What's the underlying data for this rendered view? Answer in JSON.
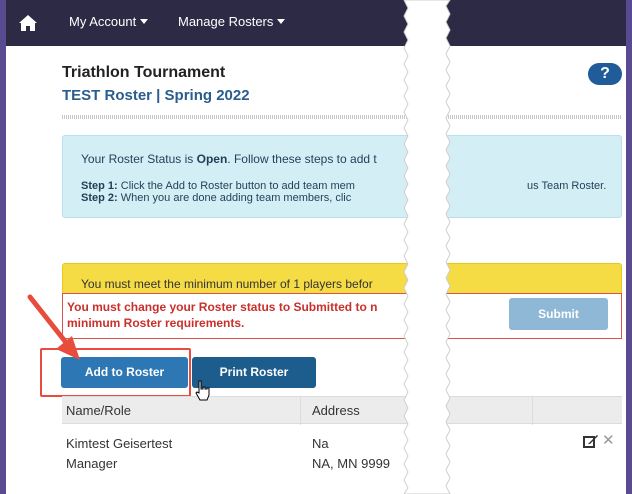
{
  "navbar": {
    "menu": [
      {
        "label": "My Account"
      },
      {
        "label": "Manage Rosters"
      }
    ],
    "colors": {
      "background": "#2c2a44"
    }
  },
  "header": {
    "title": "Triathlon Tournament",
    "subtitle": "TEST Roster | Spring 2022",
    "help_label": "?"
  },
  "info": {
    "line1_prefix": "Your Roster Status is ",
    "status": "Open",
    "line1_suffix": ". Follow these steps to add t",
    "step1_label": "Step 1:",
    "step1_text": " Click the Add to Roster button to add team mem",
    "step1_right": "us Team Roster.",
    "step2_label": "Step 2:",
    "step2_text": " When you are done adding team members, clic"
  },
  "warning": {
    "text": "You must meet the minimum number of 1 players befor"
  },
  "error": {
    "line1": "You must change your Roster status to Submitted to n",
    "line2": "minimum Roster requirements."
  },
  "buttons": {
    "submit": "Submit",
    "add_to_roster": "Add to Roster",
    "print_roster": "Print Roster"
  },
  "table": {
    "headers": [
      "Name/Role",
      "Address"
    ],
    "rows": [
      {
        "name": "Kimtest Geisertest",
        "role": "Manager",
        "address1": "Na",
        "address2": "NA, MN 9999"
      }
    ]
  },
  "icons": {
    "home": "home-icon",
    "edit": "edit-icon",
    "delete": "close-icon",
    "cursor": "hand-cursor-icon",
    "arrow": "red-arrow-annotation"
  },
  "colors": {
    "accent": "#2d77b4",
    "info_bg": "#d4eef6",
    "warning_bg": "#f5dc45",
    "error": "#d9534f",
    "annotation": "#e74c3c"
  }
}
